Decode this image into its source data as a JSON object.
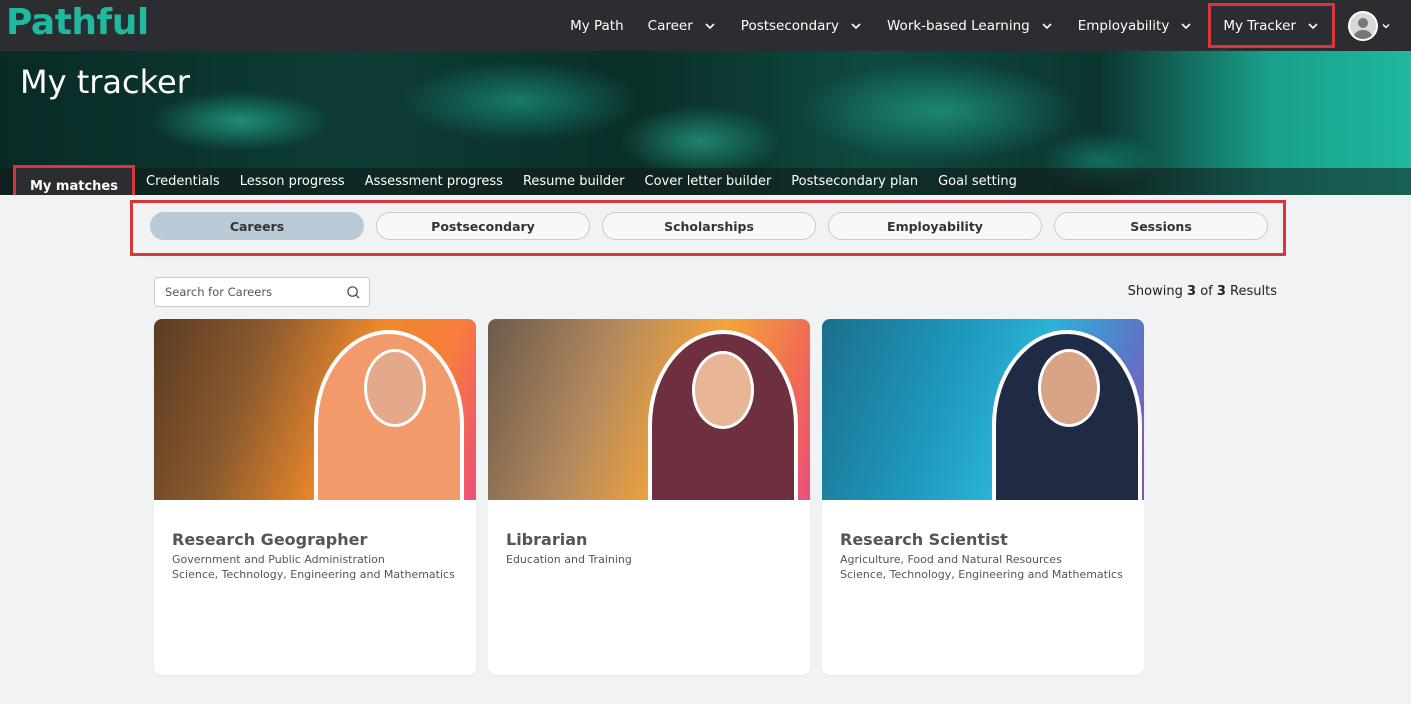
{
  "brand": {
    "logo_text": "Pathful"
  },
  "nav": {
    "items": [
      {
        "label": "My Path",
        "dropdown": false
      },
      {
        "label": "Career",
        "dropdown": true
      },
      {
        "label": "Postsecondary",
        "dropdown": true
      },
      {
        "label": "Work-based Learning",
        "dropdown": true
      },
      {
        "label": "Employability",
        "dropdown": true
      },
      {
        "label": "My Tracker",
        "dropdown": true,
        "highlighted": true
      }
    ]
  },
  "hero": {
    "title": "My tracker"
  },
  "subtabs": [
    {
      "label": "My matches",
      "active": true
    },
    {
      "label": "Credentials"
    },
    {
      "label": "Lesson progress"
    },
    {
      "label": "Assessment progress"
    },
    {
      "label": "Resume builder"
    },
    {
      "label": "Cover letter builder"
    },
    {
      "label": "Postsecondary plan"
    },
    {
      "label": "Goal setting"
    }
  ],
  "pills": [
    {
      "label": "Careers",
      "active": true
    },
    {
      "label": "Postsecondary"
    },
    {
      "label": "Scholarships"
    },
    {
      "label": "Employability"
    },
    {
      "label": "Sessions"
    }
  ],
  "search": {
    "placeholder": "Search for Careers",
    "value": ""
  },
  "results": {
    "prefix": "Showing",
    "shown": "3",
    "of": "of",
    "total": "3",
    "suffix": "Results"
  },
  "cards": [
    {
      "title": "Research Geographer",
      "categories": [
        "Government and Public Administration",
        "Science, Technology, Engineering and Mathematics"
      ]
    },
    {
      "title": "Librarian",
      "categories": [
        "Education and Training"
      ]
    },
    {
      "title": "Research Scientist",
      "categories": [
        "Agriculture, Food and Natural Resources",
        "Science, Technology, Engineering and Mathematics"
      ]
    }
  ],
  "colors": {
    "nav_bg": "#2b2d31",
    "accent_teal": "#1fb8a0",
    "highlight_red": "#d9363b",
    "active_pill": "#b9c9d6"
  }
}
